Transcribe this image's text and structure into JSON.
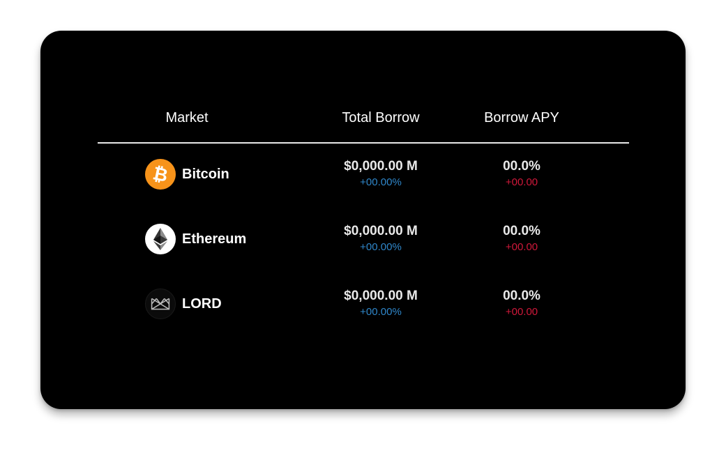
{
  "table": {
    "headers": {
      "market": "Market",
      "total_borrow": "Total Borrow",
      "borrow_apy": "Borrow APY"
    },
    "rows": [
      {
        "name": "Bitcoin",
        "icon": "bitcoin-icon",
        "total_borrow": "$0,000.00 M",
        "total_borrow_change": "+00.00%",
        "borrow_apy": "00.0%",
        "borrow_apy_change": "+00.00"
      },
      {
        "name": "Ethereum",
        "icon": "ethereum-icon",
        "total_borrow": "$0,000.00 M",
        "total_borrow_change": "+00.00%",
        "borrow_apy": "00.0%",
        "borrow_apy_change": "+00.00"
      },
      {
        "name": "LORD",
        "icon": "lord-icon",
        "total_borrow": "$0,000.00 M",
        "total_borrow_change": "+00.00%",
        "borrow_apy": "00.0%",
        "borrow_apy_change": "+00.00"
      }
    ]
  },
  "colors": {
    "card_bg": "#000000",
    "bitcoin_orange": "#f7931a",
    "change_blue": "#2f86c9",
    "change_red": "#d0183a"
  }
}
